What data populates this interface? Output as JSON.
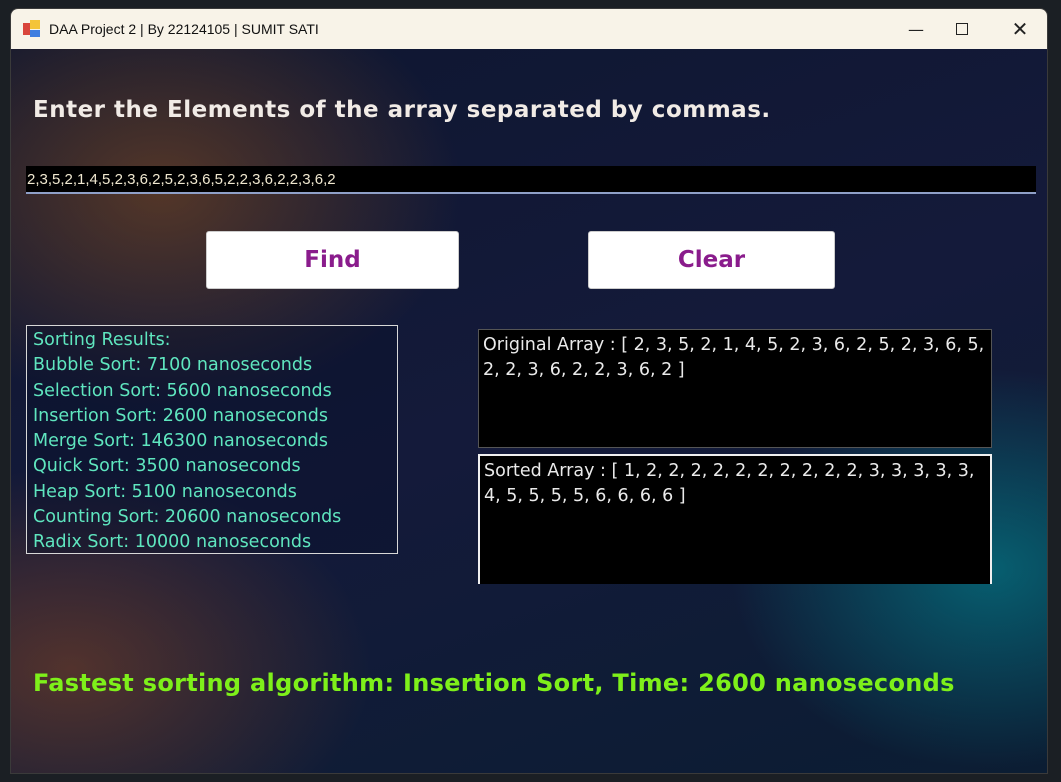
{
  "window": {
    "title": "DAA Project 2 |  By 22124105  |  SUMIT SATI",
    "minimize_icon": "minimize-icon",
    "maximize_icon": "maximize-icon",
    "close_icon": "close-icon"
  },
  "prompt": "Enter the Elements of the array separated by commas.",
  "input": {
    "value": "2,3,5,2,1,4,5,2,3,6,2,5,2,3,6,5,2,2,3,6,2,2,3,6,2"
  },
  "buttons": {
    "find": "Find",
    "clear": "Clear"
  },
  "results": {
    "header": "Sorting Results:",
    "lines": [
      "Bubble Sort: 7100 nanoseconds",
      "Selection Sort: 5600 nanoseconds",
      "Insertion Sort: 2600 nanoseconds",
      "Merge Sort: 146300 nanoseconds",
      "Quick Sort: 3500 nanoseconds",
      "Heap Sort: 5100 nanoseconds",
      "Counting Sort: 20600 nanoseconds",
      "Radix Sort: 10000 nanoseconds"
    ]
  },
  "original_array": "Original Array : [ 2, 3, 5, 2, 1, 4, 5, 2, 3, 6, 2, 5, 2, 3, 6, 5, 2, 2, 3, 6, 2, 2, 3, 6, 2 ]",
  "sorted_array": "Sorted Array : [ 1, 2, 2, 2, 2, 2, 2, 2, 2, 2, 2, 3, 3, 3, 3, 3, 4, 5, 5, 5, 5, 6, 6, 6, 6 ]",
  "fastest": "Fastest sorting algorithm: Insertion Sort, Time: 2600 nanoseconds",
  "colors": {
    "result_text": "#5fe6bf",
    "fastest_text": "#7ef01a",
    "button_text": "#8a1c8c"
  }
}
